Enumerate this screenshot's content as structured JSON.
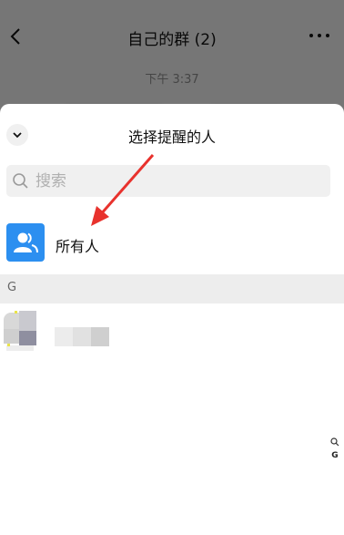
{
  "chat": {
    "status_fragment": "•",
    "title": "自己的群 (2)",
    "time": "下午 3:37"
  },
  "sheet": {
    "title": "选择提醒的人",
    "search_placeholder": "搜索",
    "search_value": "",
    "everyone_label": "所有人",
    "section_letter": "G"
  },
  "index_bar": {
    "letters": [
      "G"
    ]
  },
  "colors": {
    "accent": "#2c8ff0",
    "annotation_arrow": "#e8322d",
    "section_bg": "#ededed"
  }
}
